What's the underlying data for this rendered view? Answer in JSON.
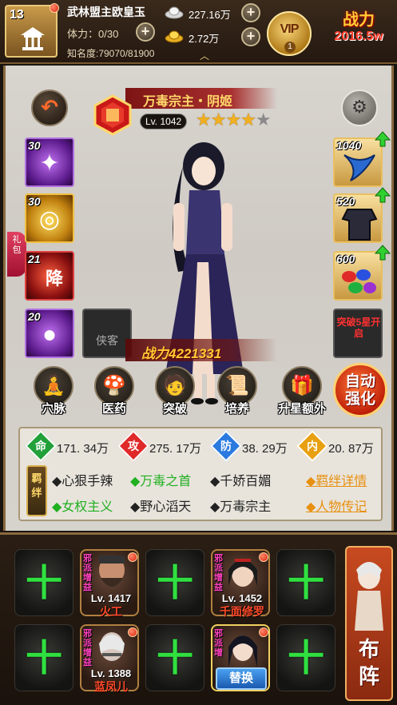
{
  "top": {
    "level": "13",
    "player_name": "武林盟主欧皇玉",
    "stamina_label": "体力：0/30",
    "fame_label": "知名度:79070/81900",
    "silver": "227.16万",
    "gold": "2.72万",
    "vip_label": "VIP",
    "vip_level": "1",
    "power_label": "战力",
    "power_value": "2016.5w"
  },
  "hero": {
    "name": "万毒宗主・阴姬",
    "level_label": "Lv. 1042",
    "stars_on": 4,
    "stars_total": 5,
    "stars_on_text": "★★★★",
    "stars_off_text": "★",
    "power_label": "战力4221331"
  },
  "gift_tab": "礼包",
  "equip_left": [
    {
      "level": "30",
      "type": "purple"
    },
    {
      "level": "30",
      "type": "gold"
    },
    {
      "level": "21",
      "type": "red",
      "glyph": "降"
    },
    {
      "level": "20",
      "type": "purple"
    },
    {
      "level": "",
      "type": "dark",
      "label": "侠客"
    }
  ],
  "equip_right": [
    {
      "level": "1040"
    },
    {
      "level": "520"
    },
    {
      "level": "600"
    },
    {
      "label": "突破5星开启"
    }
  ],
  "functions": [
    {
      "label": "穴脉",
      "icon": "meridian-icon"
    },
    {
      "label": "医药",
      "icon": "medicine-icon"
    },
    {
      "label": "突破",
      "icon": "breakthrough-icon"
    },
    {
      "label": "培养",
      "icon": "cultivate-icon"
    },
    {
      "label": "升星额外",
      "icon": "star-up-icon"
    }
  ],
  "auto_enhance": "自动强化",
  "stats": {
    "life": {
      "label": "命",
      "value": "171. 34万",
      "color": "#22a03a"
    },
    "attack": {
      "label": "攻",
      "value": "275. 17万",
      "color": "#e02a2a"
    },
    "defense": {
      "label": "防",
      "value": "38. 29万",
      "color": "#2a7ae0"
    },
    "inner": {
      "label": "内",
      "value": "20. 87万",
      "color": "#e8a010"
    }
  },
  "bond_tag": "羁绊",
  "bonds": [
    {
      "text": "◆心狠手辣",
      "active": false
    },
    {
      "text": "◆万毒之首",
      "active": true
    },
    {
      "text": "◆千娇百媚",
      "active": false
    },
    {
      "text": "◆女权主义",
      "active": true
    },
    {
      "text": "◆野心滔天",
      "active": false
    },
    {
      "text": "◆万毒宗主",
      "active": false
    }
  ],
  "links": {
    "bond_detail": "◆羁绊详情",
    "biography": "◆人物传记"
  },
  "formation": {
    "plus": "十",
    "heroes": [
      {
        "name": "火工",
        "level": "Lv. 1417",
        "faction": "邪派增益"
      },
      {
        "name": "千面修罗",
        "level": "Lv. 1452",
        "faction": "邪派增益"
      },
      {
        "name": "蓝凤儿",
        "level": "Lv. 1388",
        "faction": "邪派增益"
      },
      {
        "faction": "邪派增"
      }
    ],
    "replace_label": "替换",
    "deploy_label": "布阵"
  }
}
